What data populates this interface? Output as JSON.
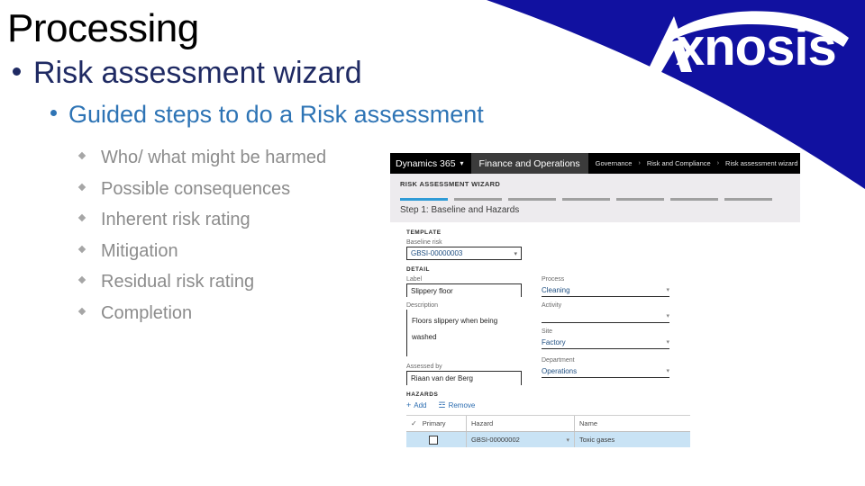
{
  "slide": {
    "title": "Processing",
    "level1": "Risk assessment wizard",
    "level2": "Guided steps to do a Risk assessment",
    "level3": [
      "Who/ what might be harmed",
      "Possible consequences",
      "Inherent risk rating",
      "Mitigation",
      "Residual risk rating",
      "Completion"
    ]
  },
  "brand": {
    "name": "Axnosis",
    "wedge_color": "#1111A0",
    "logo_color": "#FFFFFF"
  },
  "colors": {
    "title": "#000000",
    "level1": "#1F2A63",
    "level2": "#2E74B5",
    "level3": "#8C8C8C",
    "d365_accent": "#2F9BD6",
    "d365_link": "#2B6CB0",
    "grid_row_highlight": "#C9E3F5"
  },
  "d365": {
    "topbar": {
      "product": "Dynamics 365",
      "product_caret": "chevron-down",
      "module": "Finance and Operations",
      "breadcrumb": [
        "Governance",
        "Risk and Compliance",
        "Risk assessment wizard"
      ],
      "breadcrumb_separator": "›"
    },
    "page_title": "RISK ASSESSMENT WIZARD",
    "steps": {
      "total": 7,
      "active_index": 0,
      "step_title": "Step 1: Baseline and Hazards"
    },
    "sections": {
      "template": {
        "heading": "TEMPLATE",
        "baseline_risk": {
          "label": "Baseline risk",
          "value": "GBSI-00000003"
        }
      },
      "detail": {
        "heading": "DETAIL",
        "label": {
          "label": "Label",
          "value": "Slippery floor"
        },
        "process": {
          "label": "Process",
          "value": "Cleaning"
        },
        "description": {
          "label": "Description",
          "value": "Floors slippery when being washed"
        },
        "activity": {
          "label": "Activity",
          "value": ""
        },
        "site": {
          "label": "Site",
          "value": "Factory"
        },
        "assessed_by": {
          "label": "Assessed by",
          "value": "Riaan van der Berg"
        },
        "department": {
          "label": "Department",
          "value": "Operations"
        }
      },
      "hazards": {
        "heading": "HAZARDS",
        "toolbar": [
          {
            "icon": "plus-icon",
            "glyph": "+",
            "label": "Add"
          },
          {
            "icon": "trash-icon",
            "glyph": "☲",
            "label": "Remove"
          }
        ],
        "columns": [
          "Primary",
          "Hazard",
          "Name"
        ],
        "rows": [
          {
            "primary": false,
            "hazard": "GBSI-00000002",
            "name": "Toxic gases"
          }
        ]
      }
    }
  }
}
